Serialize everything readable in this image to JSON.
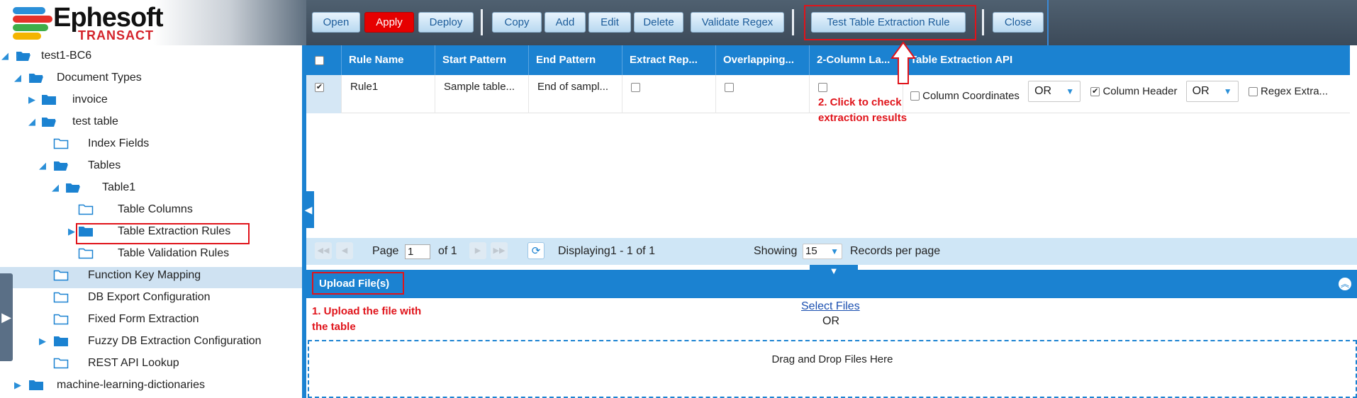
{
  "app": {
    "logo_title": "Ephesoft",
    "logo_subtitle": "TRANSACT"
  },
  "toolbar": {
    "buttons": [
      "Open",
      "Apply",
      "Deploy",
      "Copy",
      "Add",
      "Edit",
      "Delete",
      "Validate Regex",
      "Test Table Extraction Rule",
      "Close"
    ]
  },
  "tree": {
    "items": [
      {
        "label": "test1-BC6",
        "level": 0,
        "expanded": true
      },
      {
        "label": "Document Types",
        "level": 1,
        "expanded": true
      },
      {
        "label": "invoice",
        "level": 2,
        "expanded": false
      },
      {
        "label": "test table",
        "level": 2,
        "expanded": true
      },
      {
        "label": "Index Fields",
        "level": 3,
        "expanded": null
      },
      {
        "label": "Tables",
        "level": 3,
        "expanded": true
      },
      {
        "label": "Table1",
        "level": 4,
        "expanded": true
      },
      {
        "label": "Table Columns",
        "level": 5,
        "expanded": null
      },
      {
        "label": "Table Extraction Rules",
        "level": 5,
        "expanded": false,
        "selected": true
      },
      {
        "label": "Table Validation Rules",
        "level": 5,
        "expanded": null
      },
      {
        "label": "Function Key Mapping",
        "level": 3,
        "expanded": null
      },
      {
        "label": "DB Export Configuration",
        "level": 3,
        "expanded": null
      },
      {
        "label": "Fixed Form Extraction",
        "level": 3,
        "expanded": null
      },
      {
        "label": "Fuzzy DB Extraction Configuration",
        "level": 3,
        "expanded": false
      },
      {
        "label": "REST API Lookup",
        "level": 3,
        "expanded": null
      },
      {
        "label": "machine-learning-dictionaries",
        "level": 1,
        "expanded": false
      }
    ]
  },
  "grid": {
    "columns": [
      "Rule Name",
      "Start Pattern",
      "End Pattern",
      "Extract Rep...",
      "Overlapping...",
      "2-Column La...",
      "Table Extraction API"
    ],
    "row": {
      "checked": true,
      "rule_name": "Rule1",
      "start_pattern": "Sample table...",
      "end_pattern": "End of sampl...",
      "extract_rep": false,
      "overlapping": false,
      "two_column": false,
      "api": {
        "column_coordinates_label": "Column Coordinates",
        "column_coordinates_checked": false,
        "op1": "OR",
        "column_header_label": "Column Header",
        "column_header_checked": true,
        "op2": "OR",
        "regex_label": "Regex Extra...",
        "regex_checked": false
      }
    }
  },
  "pager": {
    "page_label": "Page",
    "page_value": "1",
    "of_label": "of 1",
    "displaying": "Displaying1 - 1 of 1",
    "showing_label": "Showing",
    "per_page": "15",
    "records_label": "Records per page"
  },
  "upload": {
    "title": "Upload File(s)",
    "select_files": "Select Files",
    "or": "OR",
    "drop_text": "Drag and Drop Files Here"
  },
  "annotations": {
    "step1": [
      "1. Upload the file with",
      "the table"
    ],
    "step2": [
      "2. Click to check",
      "extraction results"
    ]
  },
  "colors": {
    "accent_blue": "#1b82d1",
    "highlight_red": "#e0131a",
    "apply_red": "#e60000",
    "topbar_bg": "#455565"
  }
}
